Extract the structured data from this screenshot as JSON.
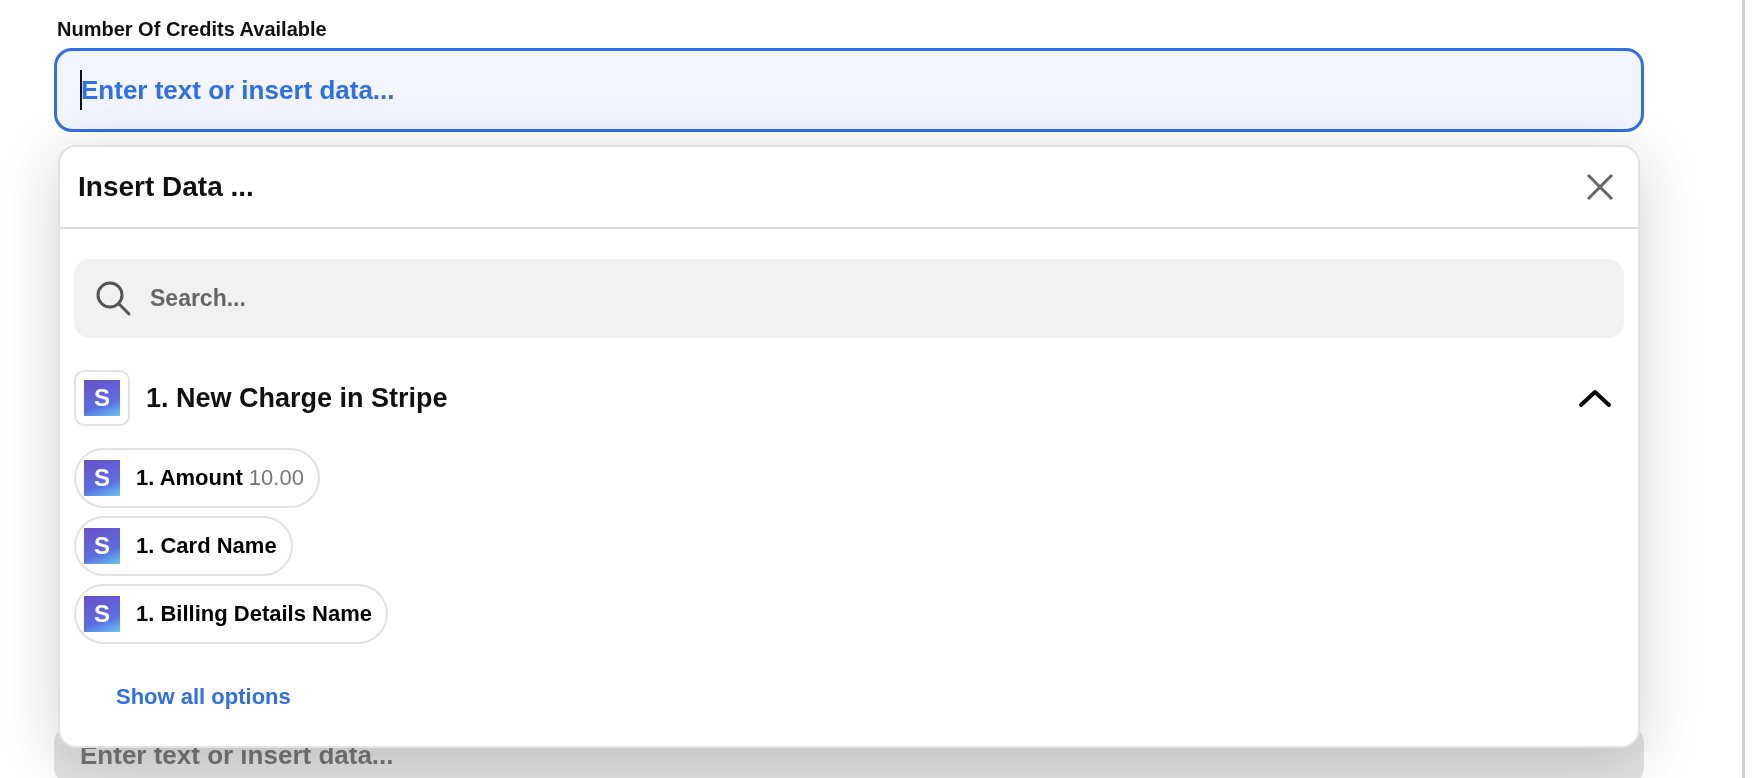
{
  "field": {
    "label": "Number Of Credits Available",
    "placeholder": "Enter text or insert data...",
    "focused": true
  },
  "popup": {
    "title": "Insert Data ...",
    "search": {
      "placeholder": "Search..."
    },
    "sections": [
      {
        "icon_text": "S",
        "title": "1. New Charge in Stripe",
        "expanded": true,
        "items": [
          {
            "icon_text": "S",
            "label": "1. Amount",
            "value": "10.00"
          },
          {
            "icon_text": "S",
            "label": "1. Card Name"
          },
          {
            "icon_text": "S",
            "label": "1. Billing Details Name"
          }
        ]
      }
    ],
    "show_all": "Show all options"
  },
  "next_field": {
    "placeholder": "Enter text or insert data..."
  }
}
